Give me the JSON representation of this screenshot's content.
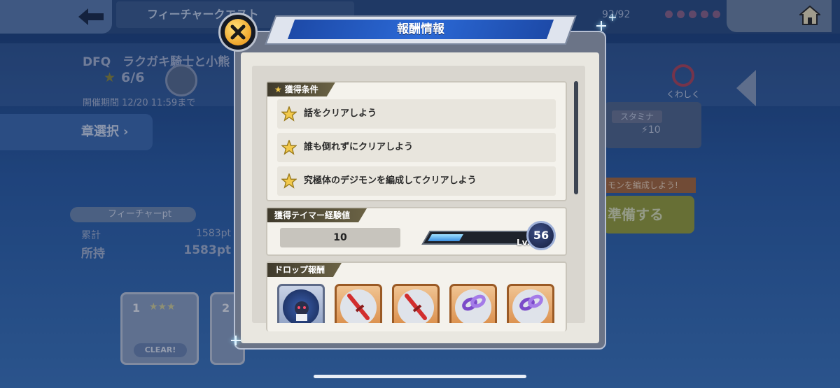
{
  "background": {
    "header_title": "フィーチャークエスト",
    "stamina_counter": "92/92",
    "quest_title": "DFQ　ラクガキ騎士と小熊",
    "star_progress": "6/6",
    "period": "開催期間 12/20 11:59まで",
    "chapter_select": "章選択",
    "feature_pt_label": "フィーチャーpt",
    "total_label": "累計",
    "total_value": "1583pt",
    "owned_label": "所持",
    "owned_value": "1583pt",
    "zoom_label": "くわしく",
    "stamina_label": "スタミナ",
    "stamina_cost": "10",
    "recommend_note": "モンを編成しよう!",
    "start_button": "準備する",
    "cards": [
      {
        "num": "1",
        "stars": "★★★",
        "status": "CLEAR!"
      },
      {
        "num": "2",
        "stars": "",
        "status": ""
      }
    ]
  },
  "modal": {
    "title": "報酬情報",
    "conditions_header": "獲得条件",
    "conditions": [
      "話をクリアしよう",
      "誰も倒れずにクリアしよう",
      "究極体のデジモンを編成してクリアしよう"
    ],
    "exp_header": "獲得テイマー経験値",
    "exp_value": "10",
    "level_prefix": "Lv.",
    "level": "56",
    "exp_progress": 0.3,
    "drop_header": "ドロップ報酬",
    "drops": [
      {
        "icon": "digimon-portrait-icon",
        "frame": "blue"
      },
      {
        "icon": "sword-chip-icon",
        "frame": "orange"
      },
      {
        "icon": "sword-chip-icon",
        "frame": "orange"
      },
      {
        "icon": "chain-chip-icon",
        "frame": "purple"
      },
      {
        "icon": "chain-chip-icon",
        "frame": "purple"
      }
    ]
  },
  "colors": {
    "title_stripe": "#2b69d6",
    "section_header": "#3f3a2c",
    "star": "#f2c94c"
  }
}
